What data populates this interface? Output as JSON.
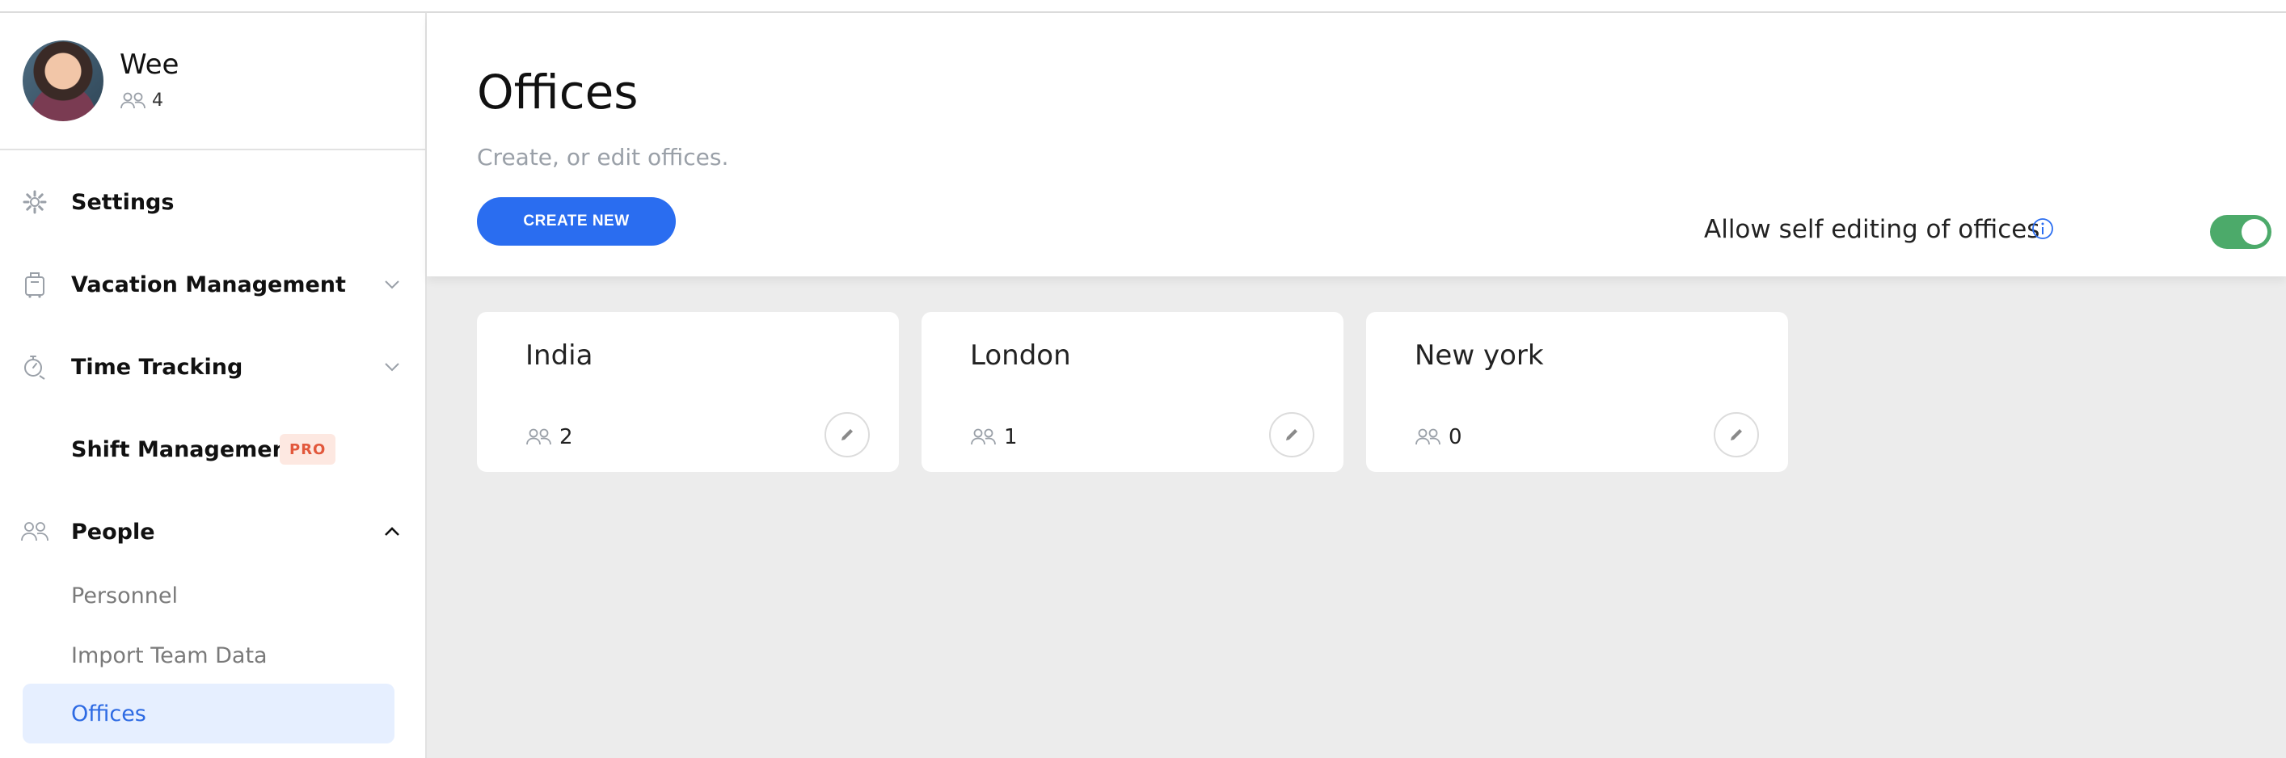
{
  "profile": {
    "name": "Wee",
    "member_count": "4"
  },
  "sidebar": {
    "items": [
      {
        "label": "Settings",
        "icon": "gear-icon"
      },
      {
        "label": "Vacation Management",
        "icon": "luggage-icon",
        "expandable": true
      },
      {
        "label": "Time Tracking",
        "icon": "stopwatch-icon",
        "expandable": true
      },
      {
        "label": "Shift Management",
        "badge": "PRO"
      },
      {
        "label": "People",
        "icon": "people-icon",
        "expanded": true
      }
    ],
    "people_subitems": [
      {
        "label": "Personnel"
      },
      {
        "label": "Import Team Data"
      },
      {
        "label": "Offices",
        "active": true
      }
    ]
  },
  "page": {
    "title": "Offices",
    "subtitle": "Create, or edit offices.",
    "create_button": "CREATE NEW",
    "self_edit_label": "Allow self editing of offices",
    "self_edit_enabled": true
  },
  "offices": [
    {
      "name": "India",
      "members": "2"
    },
    {
      "name": "London",
      "members": "1"
    },
    {
      "name": "New york",
      "members": "0"
    }
  ],
  "colors": {
    "accent": "#2a6df0",
    "toggle_on": "#4caa6a",
    "pro_badge": "#e2583c"
  }
}
